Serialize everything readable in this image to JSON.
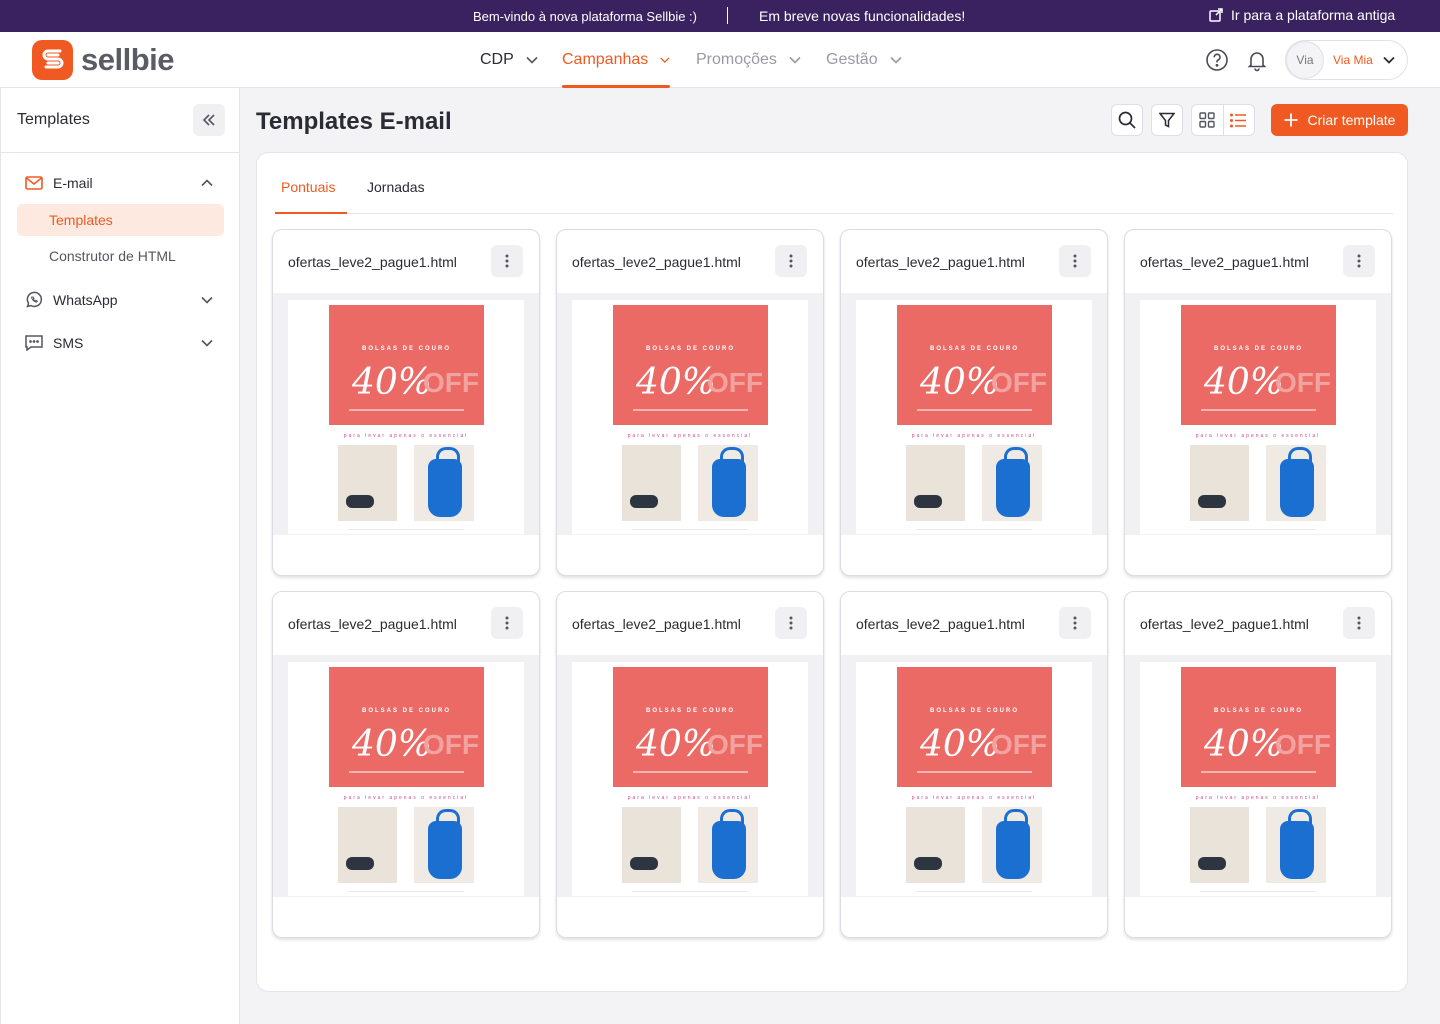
{
  "banner": {
    "welcome": "Bem-vindo à nova plataforma Sellbie :)",
    "soon": "Em breve novas funcionalidades!",
    "old_platform": "Ir para a plataforma antiga"
  },
  "header": {
    "logo_text": "sellbie",
    "nav": [
      {
        "label": "CDP"
      },
      {
        "label": "Campanhas"
      },
      {
        "label": "Promoções"
      },
      {
        "label": "Gestão"
      }
    ],
    "user": {
      "avatar": "Via",
      "name": "Via Mia"
    }
  },
  "sidebar": {
    "title": "Templates",
    "email": {
      "label": "E-mail",
      "items": [
        {
          "label": "Templates"
        },
        {
          "label": "Construtor de HTML"
        }
      ]
    },
    "whatsapp": "WhatsApp",
    "sms": "SMS"
  },
  "main": {
    "title": "Templates E-mail",
    "create_label": "Criar template",
    "tabs": [
      {
        "label": "Pontuais"
      },
      {
        "label": "Jornadas"
      }
    ],
    "cards": [
      {
        "name": "ofertas_leve2_pague1.html"
      },
      {
        "name": "ofertas_leve2_pague1.html"
      },
      {
        "name": "ofertas_leve2_pague1.html"
      },
      {
        "name": "ofertas_leve2_pague1.html"
      },
      {
        "name": "ofertas_leve2_pague1.html"
      },
      {
        "name": "ofertas_leve2_pague1.html"
      },
      {
        "name": "ofertas_leve2_pague1.html"
      },
      {
        "name": "ofertas_leve2_pague1.html"
      }
    ],
    "preview": {
      "headline": "BOLSAS DE COURO",
      "percent": "40%",
      "off": "OFF",
      "tagline": "para levar apenas o essencial"
    }
  },
  "colors": {
    "accent": "#f05a22",
    "banner": "#3a2260",
    "hero": "#ec6a65"
  }
}
